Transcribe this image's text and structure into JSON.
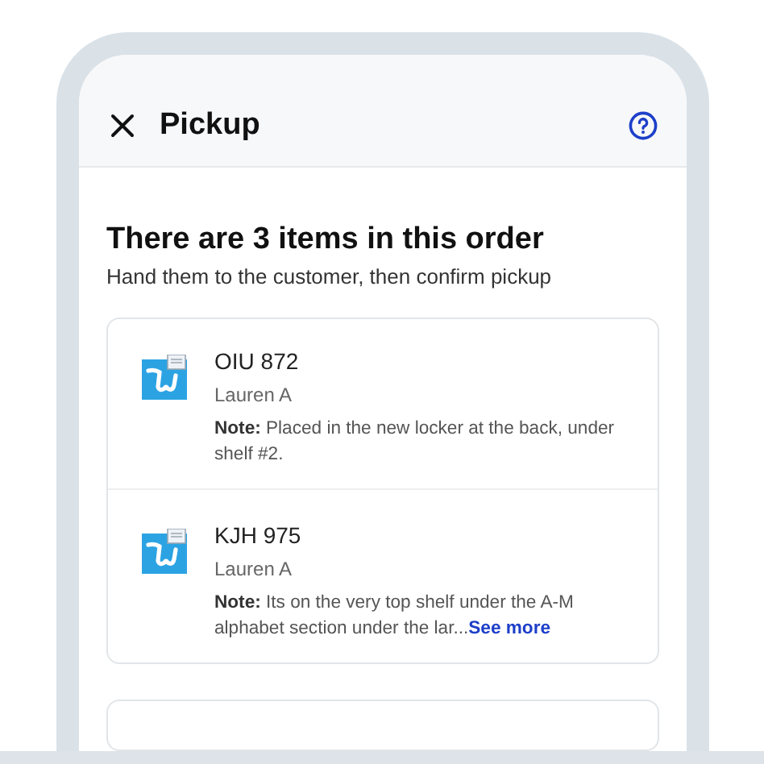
{
  "header": {
    "title": "Pickup"
  },
  "order": {
    "heading": "There are 3 items in this order",
    "subtitle": "Hand them to the customer, then confirm pickup"
  },
  "items": [
    {
      "code": "OIU 872",
      "customer": "Lauren A",
      "note": "**Note:** Placed in the new locker at the back, under shelf #2."
    },
    {
      "code": "KJH 975",
      "customer": "Lauren A",
      "note": "**Note:** Its on the very top shelf under the A-M alphabet section under the lar...",
      "see_more": "See more"
    }
  ]
}
